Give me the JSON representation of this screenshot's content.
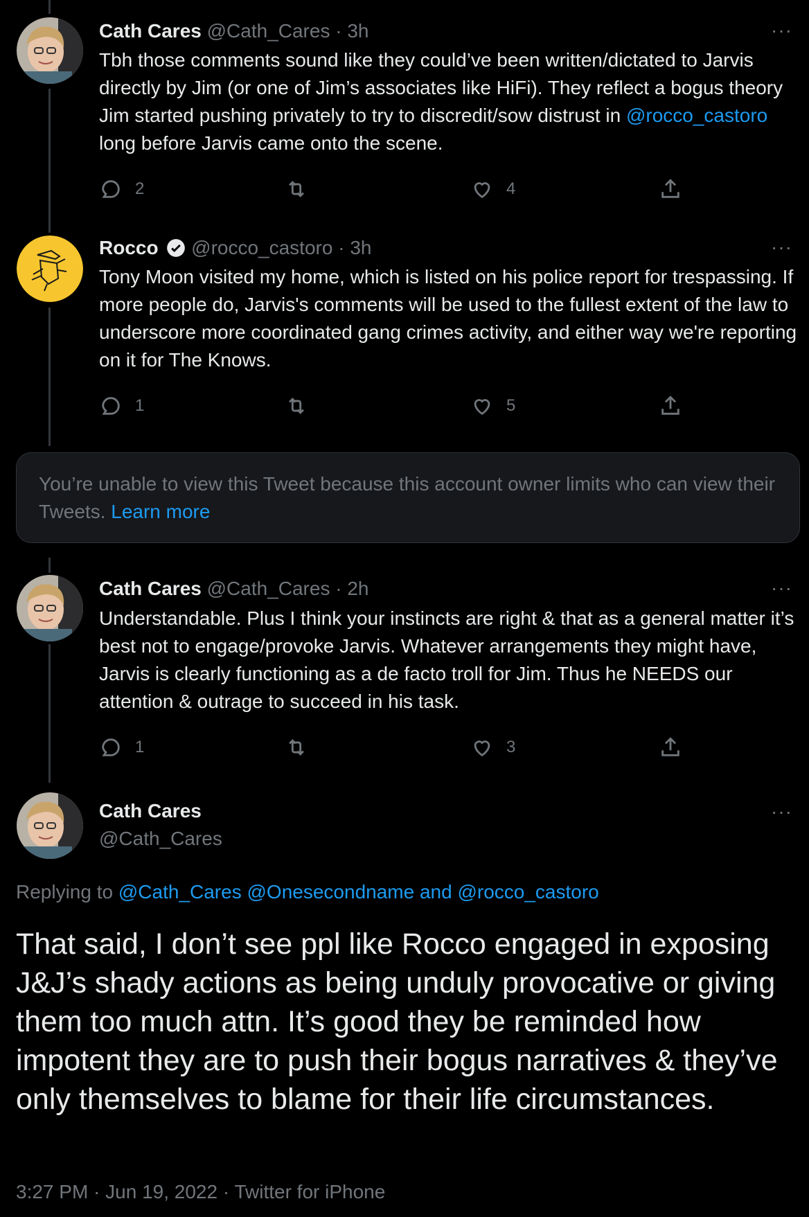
{
  "tweets": [
    {
      "name": "Cath Cares",
      "handle": "@Cath_Cares",
      "time": "3h",
      "text_parts": [
        "Tbh those comments sound like they could’ve been written/dictated to Jarvis directly by Jim (or one of Jim’s associates like HiFi). They reflect a bogus theory Jim started pushing privately to try to discredit/sow distrust in ",
        " long before Jarvis came onto the scene."
      ],
      "mention": "@rocco_castoro",
      "replies": "2",
      "retweets": "",
      "likes": "4"
    },
    {
      "name": "Rocco",
      "handle": "@rocco_castoro",
      "time": "3h",
      "text": "Tony Moon visited my home, which is listed on his  police report for trespassing. If more people do, Jarvis's comments will be used to the fullest extent of the law to underscore more coordinated gang crimes activity, and either way we're reporting on it for The Knows.",
      "replies": "1",
      "retweets": "",
      "likes": "5"
    },
    {
      "name": "Cath Cares",
      "handle": "@Cath_Cares",
      "time": "2h",
      "text": "Understandable. Plus I think your instincts are right & that as a general matter it’s best not to engage/provoke Jarvis. Whatever arrangements they might have, Jarvis is clearly functioning as a de facto troll for Jim. Thus he NEEDS our attention & outrage to succeed in his task.",
      "replies": "1",
      "retweets": "",
      "likes": "3"
    }
  ],
  "separator": "·",
  "more_label": "···",
  "unavailable": {
    "text": "You’re unable to view this Tweet because this account owner limits who can view their Tweets.",
    "link": "Learn more"
  },
  "main": {
    "name": "Cath Cares",
    "handle": "@Cath_Cares",
    "replying_prefix": "Replying to",
    "replying_1": "@Cath_Cares",
    "replying_2": "@Onesecondname",
    "replying_and": "and",
    "replying_3": "@rocco_castoro",
    "text": "That said, I don’t see ppl like Rocco engaged in exposing J&J’s shady actions as being unduly provocative or giving them too much attn. It’s good they be reminded how impotent they are to push their bogus narratives & they’ve only themselves to blame for their life circumstances.",
    "meta": "3:27 PM · Jun 19, 2022 · Twitter for iPhone"
  },
  "colors": {
    "background": "#000000",
    "text": "#e7e9ea",
    "muted": "#71767b",
    "link": "#1d9bf0",
    "rocco_avatar": "#f7c62f"
  },
  "icons": [
    "reply-icon",
    "retweet-icon",
    "like-icon",
    "share-icon",
    "verified-badge-icon",
    "more-icon"
  ]
}
